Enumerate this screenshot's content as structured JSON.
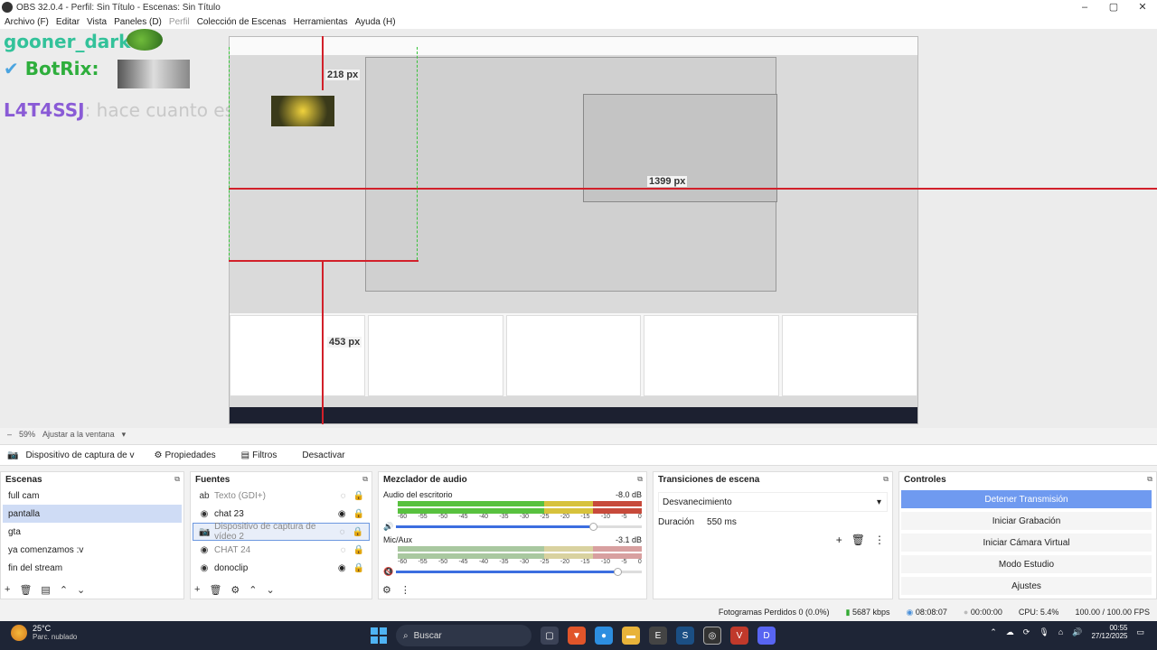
{
  "window": {
    "title": "OBS 32.0.4 - Perfil: Sin Título - Escenas: Sin Título",
    "minimize": "–",
    "maximize": "▢",
    "close": "✕"
  },
  "menu": [
    "Archivo (F)",
    "Editar",
    "Vista",
    "Paneles (D)",
    "Perfil",
    "Colección de Escenas",
    "Herramientas",
    "Ayuda (H)"
  ],
  "preview": {
    "chat1_user": "gooner_dark",
    "chat1_sep": ":",
    "chat2_user": "BotRix",
    "chat2_sep": ":",
    "chat3_user": "L4T4SSJ",
    "chat3_msg": ": hace cuanto está así",
    "px_labels": [
      "218 px",
      "1399 px",
      "453 px"
    ]
  },
  "zoom": {
    "value": "59%",
    "fit": "Ajustar a la ventana"
  },
  "source_bar": {
    "current_source": "Dispositivo de captura de v",
    "properties": "Propiedades",
    "filters": "Filtros",
    "deactivate": "Desactivar"
  },
  "scenes": {
    "title": "Escenas",
    "items": [
      "full cam",
      "pantalla",
      "gta",
      "ya comenzamos :v",
      "fin del stream"
    ],
    "selected_index": 1
  },
  "sources": {
    "title": "Fuentes",
    "items": [
      {
        "name": "Texto (GDI+)",
        "icon": "text-icon",
        "visible": false
      },
      {
        "name": "chat 23",
        "icon": "browser-icon",
        "visible": true
      },
      {
        "name": "Dispositivo de captura de vídeo 2",
        "icon": "camera-icon",
        "visible": false
      },
      {
        "name": "CHAT 24",
        "icon": "browser-icon",
        "visible": false
      },
      {
        "name": "donoclip",
        "icon": "browser-icon",
        "visible": true
      }
    ]
  },
  "mixer": {
    "title": "Mezclador de audio",
    "channels": [
      {
        "name": "Audio del escritorio",
        "db": "-8.0 dB",
        "volume": 0.8
      },
      {
        "name": "Mic/Aux",
        "db": "-3.1 dB",
        "volume": 0.9
      }
    ],
    "ticks": [
      "-60",
      "-55",
      "-50",
      "-45",
      "-40",
      "-35",
      "-30",
      "-25",
      "-20",
      "-15",
      "-10",
      "-5",
      "0"
    ]
  },
  "transitions": {
    "title": "Transiciones de escena",
    "type": "Desvanecimiento",
    "duration_label": "Duración",
    "duration_value": "550 ms"
  },
  "controls": {
    "title": "Controles",
    "stop_stream": "Detener Transmisión",
    "start_record": "Iniciar Grabación",
    "virtual_cam": "Iniciar Cámara Virtual",
    "studio_mode": "Modo Estudio",
    "settings": "Ajustes"
  },
  "status": {
    "dropped": "Fotogramas Perdidos 0 (0.0%)",
    "bitrate": "5687 kbps",
    "stream_time": "08:08:07",
    "rec_time": "00:00:00",
    "cpu": "CPU: 5.4%",
    "fps": "100.00 / 100.00 FPS"
  },
  "taskbar": {
    "temp": "25°C",
    "weather": "Parc. nublado",
    "search": "Buscar",
    "time": "00:55",
    "date": "27/12/2025"
  },
  "colors": {
    "accent": "#6f9af0",
    "selection": "#cfdcf5",
    "guide_red": "#d2202a",
    "guide_green": "#38c23a"
  }
}
